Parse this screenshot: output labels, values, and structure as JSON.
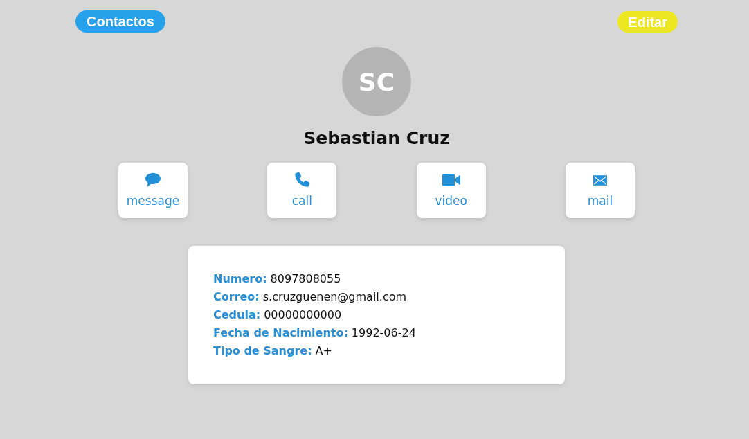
{
  "header": {
    "back_button": "Contactos",
    "edit_button": "Editar"
  },
  "contact": {
    "initials": "SC",
    "name": "Sebastian Cruz"
  },
  "actions": [
    {
      "kind": "message",
      "label": "message"
    },
    {
      "kind": "call",
      "label": "call"
    },
    {
      "kind": "video",
      "label": "video"
    },
    {
      "kind": "mail",
      "label": "mail"
    }
  ],
  "details": [
    {
      "label": "Numero:",
      "value": "8097808055"
    },
    {
      "label": "Correo:",
      "value": "s.cruzguenen@gmail.com"
    },
    {
      "label": "Cedula:",
      "value": "00000000000"
    },
    {
      "label": "Fecha de Nacimiento:",
      "value": "1992-06-24"
    },
    {
      "label": "Tipo de Sangre:",
      "value": "A+"
    }
  ]
}
